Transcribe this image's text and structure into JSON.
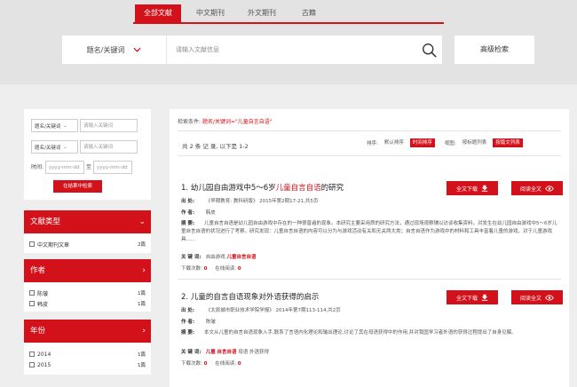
{
  "tabs": [
    {
      "label": "全部文献",
      "active": true
    },
    {
      "label": "中文期刊",
      "active": false
    },
    {
      "label": "外文期刊",
      "active": false
    },
    {
      "label": "古籍",
      "active": false
    }
  ],
  "search": {
    "field_label": "题名/关键词",
    "placeholder": "请输入文献信息",
    "value": "",
    "advanced_label": "高级检索"
  },
  "filter": {
    "rows": [
      {
        "field": "题名/关键词",
        "placeholder": "请输入关键词"
      },
      {
        "field": "题名/关键词",
        "placeholder": "请输入关键词"
      }
    ],
    "time_label": "时间:",
    "date_placeholder": "yyyy-mm-dd",
    "date_separator": "至",
    "search_in_result": "在结果中检索"
  },
  "facets": [
    {
      "title": "文献类型",
      "items": [
        {
          "label": "中文期刊文章",
          "count": "2篇"
        }
      ]
    },
    {
      "title": "作者",
      "items": [
        {
          "label": "陈皱",
          "count": "1篇"
        },
        {
          "label": "韩皮",
          "count": "1篇"
        }
      ]
    },
    {
      "title": "年份",
      "items": [
        {
          "label": "2014",
          "count": "1篇"
        },
        {
          "label": "2015",
          "count": "1篇"
        }
      ]
    }
  ],
  "results": {
    "criteria_prefix": "检索条件:",
    "criteria_value": "题名/关键词=\"儿童自言自语\"",
    "count_text": "共 2 条 记 录, 以下是 1-2",
    "sort_label": "排序:",
    "sort_default": "默认排序",
    "sort_time": "时间排序",
    "view_label": "视图:",
    "view_abstract": "按标题列表",
    "view_full": "按篇文列表",
    "download_label": "全文下载",
    "read_label": "阅读全文",
    "labels": {
      "source": "出    处:",
      "author": "作    者:",
      "abstract": "摘    要:",
      "keywords": "关 键 词:"
    },
    "downloads_label": "下载次数:",
    "reads_label": "在线阅读:",
    "items": [
      {
        "num": "1.",
        "title_pre": "幼儿园自由游戏中5～6岁",
        "title_hl": "儿童自言自语",
        "title_post": "的研究",
        "source": "《早期教育: 教科研版》 2015年第2期17-21,共5页",
        "author": "韩皮",
        "abstract": "儿童自言自语是幼儿园自由游戏中存在的一种很普遍的现象。本研究主要采用质的研究方法，通过现场观察辅以访谈收集资料，对发生在幼儿园自由游戏中5～6岁儿童自言自语的状况进行了考察。研究发现：儿童自言自语的内容可以分为与游戏活动有关和无关两大类；自言自语作为游戏中的材料和工具丰富着儿童的游戏，对于儿童游戏具......",
        "keywords": [
          "自由游戏",
          "儿童自言自语"
        ],
        "keywords_hl": [
          false,
          true
        ],
        "downloads": "0",
        "reads": "0"
      },
      {
        "num": "2.",
        "title_pre": "儿童的自言自语现象对外语获得的启示",
        "title_hl": "",
        "title_post": "",
        "source": "《太原城市职业技术学院学报》 2014年第7期113-114,共2页",
        "author": "陈皱",
        "abstract": "本文从儿童的自言自语现象入手,联系了言语内化理论和输出理论,讨论了其在母语获得中的作用,并对我国学习者外语的获得过程提出了自身见解。",
        "keywords": [
          "儿童",
          "自言自语",
          "母语",
          "外语获得"
        ],
        "keywords_hl": [
          true,
          true,
          false,
          false
        ],
        "downloads": "0",
        "reads": "0"
      }
    ]
  },
  "colors": {
    "accent": "#d2111b",
    "band": "#e3e3e3",
    "page_bg": "#eeeeee"
  }
}
